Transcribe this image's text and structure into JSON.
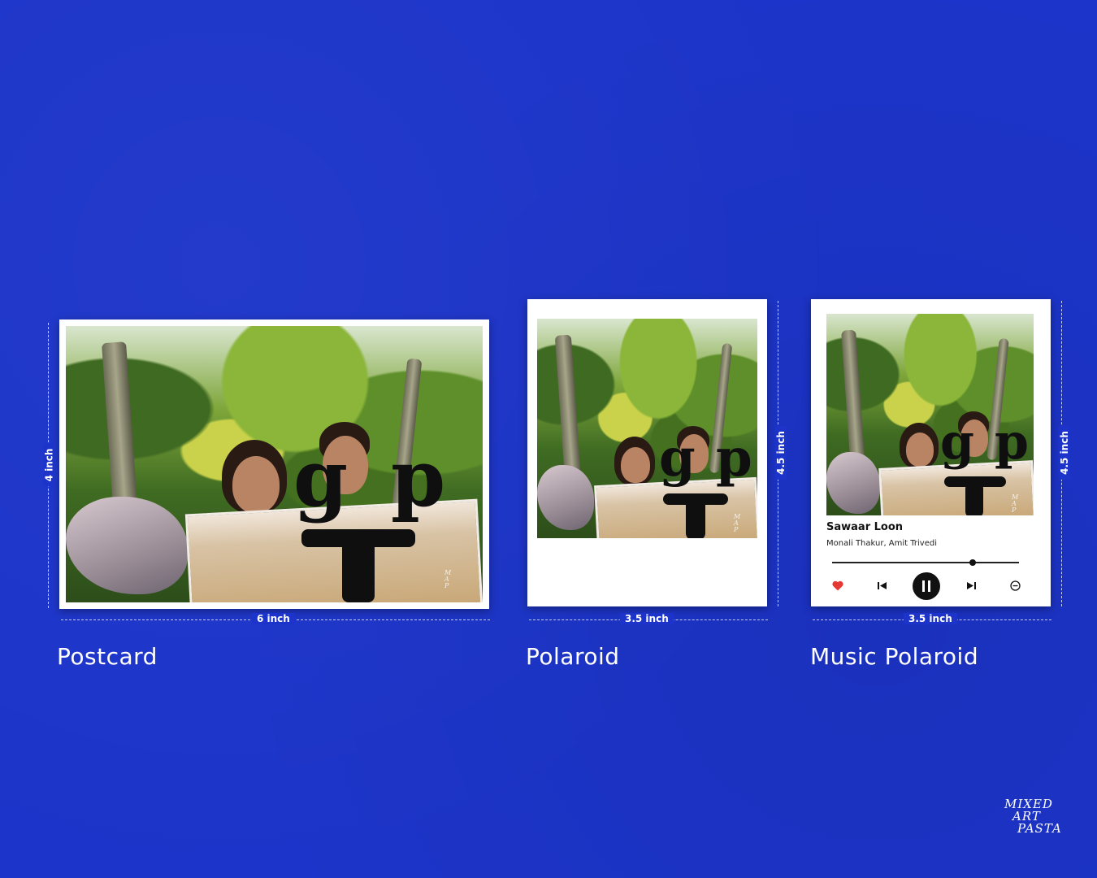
{
  "background_color": "#1c34c9",
  "products": [
    {
      "name": "Postcard",
      "width_label": "6 inch",
      "height_label": "4 inch"
    },
    {
      "name": "Polaroid",
      "width_label": "3.5 inch",
      "height_label": "4.5 inch"
    },
    {
      "name": "Music Polaroid",
      "width_label": "3.5 inch",
      "height_label": "4.5 inch"
    }
  ],
  "music_player": {
    "song_title": "Sawaar Loon",
    "artist": "Monali Thakur, Amit Trivedi",
    "progress": 0.75,
    "controls": [
      "heart-icon",
      "previous-icon",
      "pause-icon",
      "next-icon",
      "remove-icon"
    ],
    "heart_color": "#e53935"
  },
  "brand": {
    "logo_lines": [
      "MIXED",
      "ART",
      "PASTA"
    ]
  }
}
